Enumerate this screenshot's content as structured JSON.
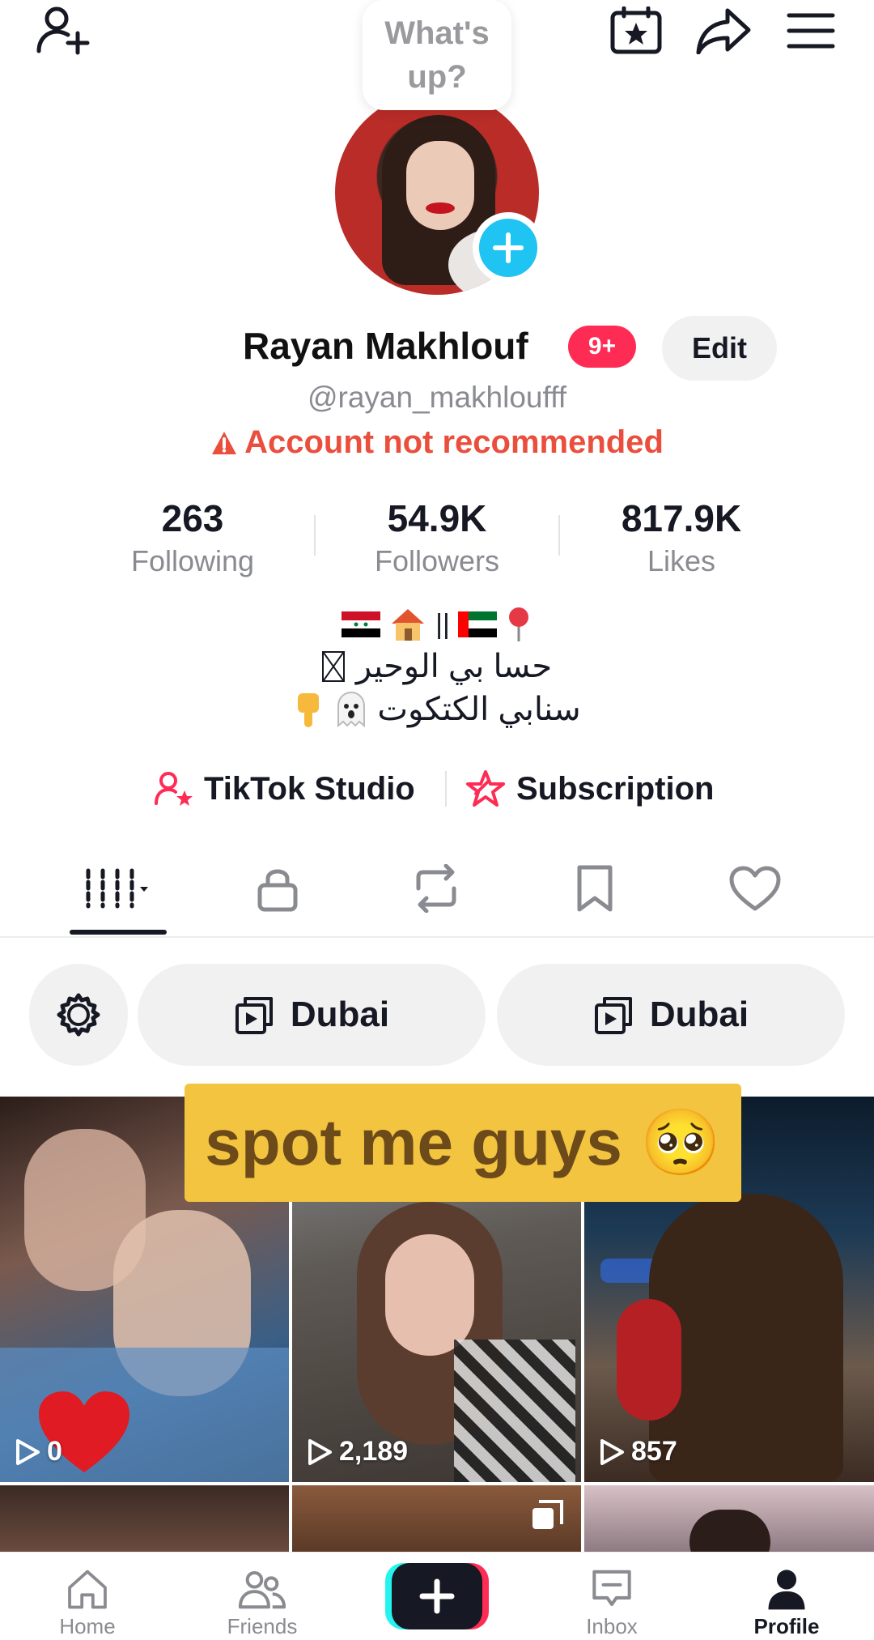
{
  "bubble": {
    "text": "What's up?"
  },
  "profile": {
    "name": "Rayan Makhlouf",
    "notification_badge": "9+",
    "edit_label": "Edit",
    "handle": "@rayan_makhloufff",
    "warning": "Account not recommended"
  },
  "stats": [
    {
      "value": "263",
      "label": "Following"
    },
    {
      "value": "54.9K",
      "label": "Followers"
    },
    {
      "value": "817.9K",
      "label": "Likes"
    }
  ],
  "bio": {
    "line1_separator": "||",
    "line2": "حسا بي الوحير",
    "line3": "سنابي الكتكوت"
  },
  "studio": {
    "studio_label": "TikTok Studio",
    "subscription_label": "Subscription"
  },
  "tabs": [
    "videos-grid",
    "private",
    "reposts",
    "favorites",
    "liked"
  ],
  "chips": [
    {
      "label": "Dubai"
    },
    {
      "label": "Dubai"
    }
  ],
  "caption": "spot me guys 🥺",
  "videos": [
    {
      "views": "0"
    },
    {
      "views": "2,189"
    },
    {
      "views": "857"
    }
  ],
  "nav": {
    "home": "Home",
    "friends": "Friends",
    "inbox": "Inbox",
    "profile": "Profile"
  },
  "colors": {
    "accent": "#fe2c55",
    "cyan": "#20c4f2",
    "warning": "#ea4e3d",
    "caption_bg": "#f2c440"
  }
}
